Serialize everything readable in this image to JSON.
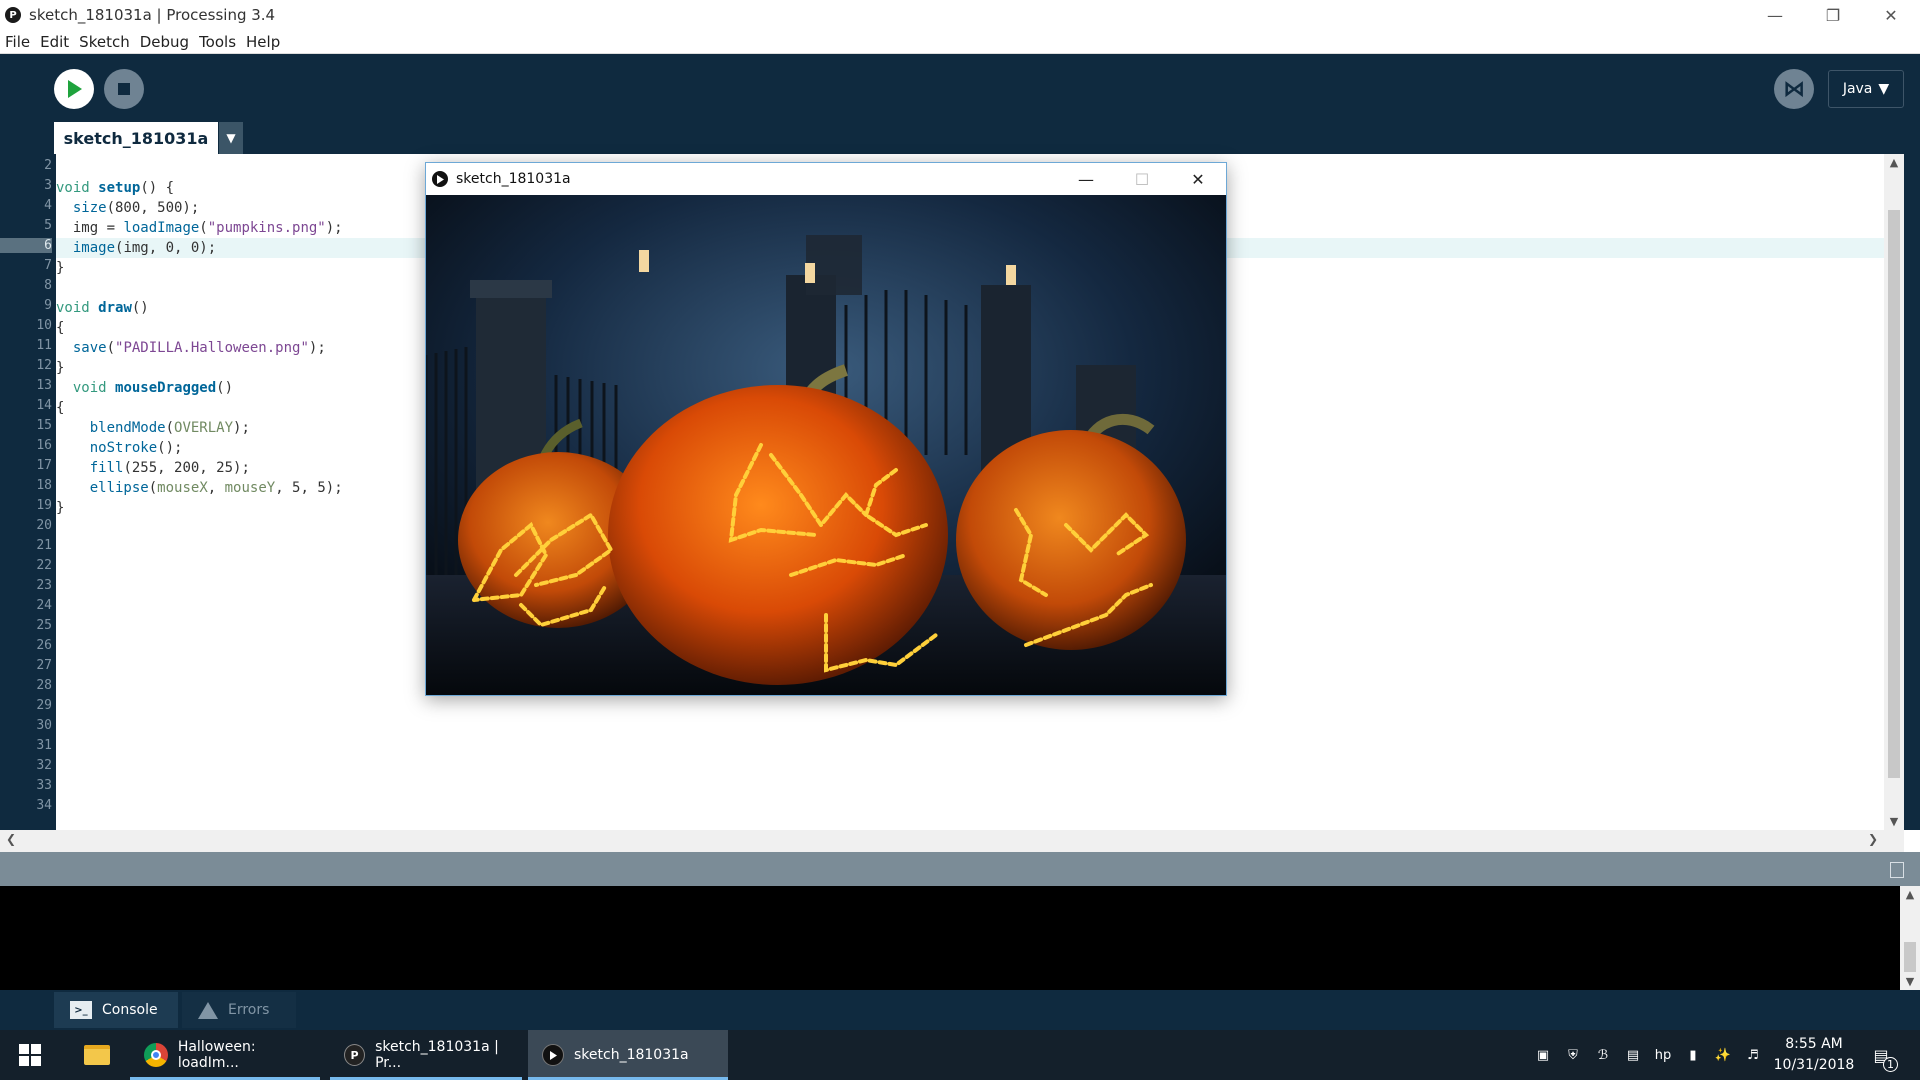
{
  "window": {
    "title": "sketch_181031a | Processing 3.4",
    "app_icon": "processing-icon"
  },
  "menu": [
    "File",
    "Edit",
    "Sketch",
    "Debug",
    "Tools",
    "Help"
  ],
  "toolbar": {
    "run_icon": "play-icon",
    "stop_icon": "stop-icon",
    "mode": "Java",
    "debugger_icon": "butterfly-icon"
  },
  "tab": {
    "name": "sketch_181031a"
  },
  "editor": {
    "current_line": 6,
    "line_numbers": [
      "2",
      "3",
      "4",
      "5",
      "6",
      "7",
      "8",
      "9",
      "10",
      "11",
      "12",
      "13",
      "14",
      "15",
      "16",
      "17",
      "18",
      "19",
      "20",
      "21",
      "22",
      "23",
      "24",
      "25",
      "26",
      "27",
      "28",
      "29",
      "30",
      "31",
      "32",
      "33",
      "34"
    ],
    "code_lines": [
      "",
      "void setup() {",
      "  size(800, 500);",
      "  img = loadImage(\"pumpkins.png\");",
      "  image(img, 0, 0);",
      "}",
      "",
      "void draw()",
      "{",
      "  save(\"PADILLA.Halloween.png\");",
      "}",
      "  void mouseDragged()",
      "{",
      "    blendMode(OVERLAY);",
      "    noStroke();",
      "    fill(255, 200, 25);",
      "    ellipse(mouseX, mouseY, 5, 5);",
      "}"
    ]
  },
  "console": {
    "tabs": [
      {
        "label": "Console",
        "icon": "terminal-icon"
      },
      {
        "label": "Errors",
        "icon": "warning-icon"
      }
    ]
  },
  "sketch_window": {
    "title": "sketch_181031a",
    "icon": "play-icon"
  },
  "taskbar": {
    "items": [
      {
        "label": "",
        "icon": "file-explorer-icon"
      },
      {
        "label": "Halloween: loadIm...",
        "icon": "chrome-icon"
      },
      {
        "label": "sketch_181031a | Pr...",
        "icon": "processing-icon"
      },
      {
        "label": "sketch_181031a",
        "icon": "play-icon"
      }
    ],
    "time": "8:55 AM",
    "date": "10/31/2018",
    "notifications": "1"
  },
  "colors": {
    "ide_dark": "#0f2a3f",
    "keyword": "#33997e",
    "function": "#006699",
    "string": "#7d4793",
    "constant": "#718a62",
    "glow": "#ffc832"
  }
}
